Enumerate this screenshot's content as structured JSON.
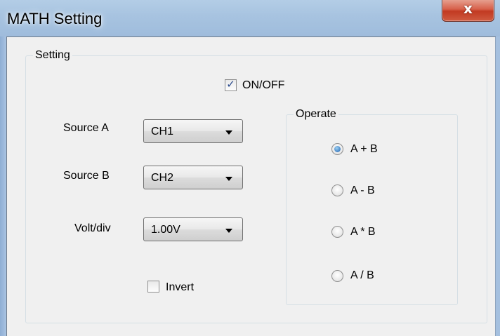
{
  "window": {
    "title": "MATH Setting",
    "close_glyph": "x"
  },
  "setting": {
    "group_label": "Setting",
    "onoff": {
      "label": "ON/OFF",
      "checked": true
    },
    "source_a": {
      "label": "Source A",
      "value": "CH1"
    },
    "source_b": {
      "label": "Source B",
      "value": "CH2"
    },
    "volt_div": {
      "label": "Volt/div",
      "value": "1.00V"
    },
    "invert": {
      "label": "Invert",
      "checked": false
    }
  },
  "operate": {
    "group_label": "Operate",
    "options": [
      {
        "label": "A + B",
        "selected": true
      },
      {
        "label": "A - B",
        "selected": false
      },
      {
        "label": "A * B",
        "selected": false
      },
      {
        "label": "A / B",
        "selected": false
      }
    ]
  }
}
